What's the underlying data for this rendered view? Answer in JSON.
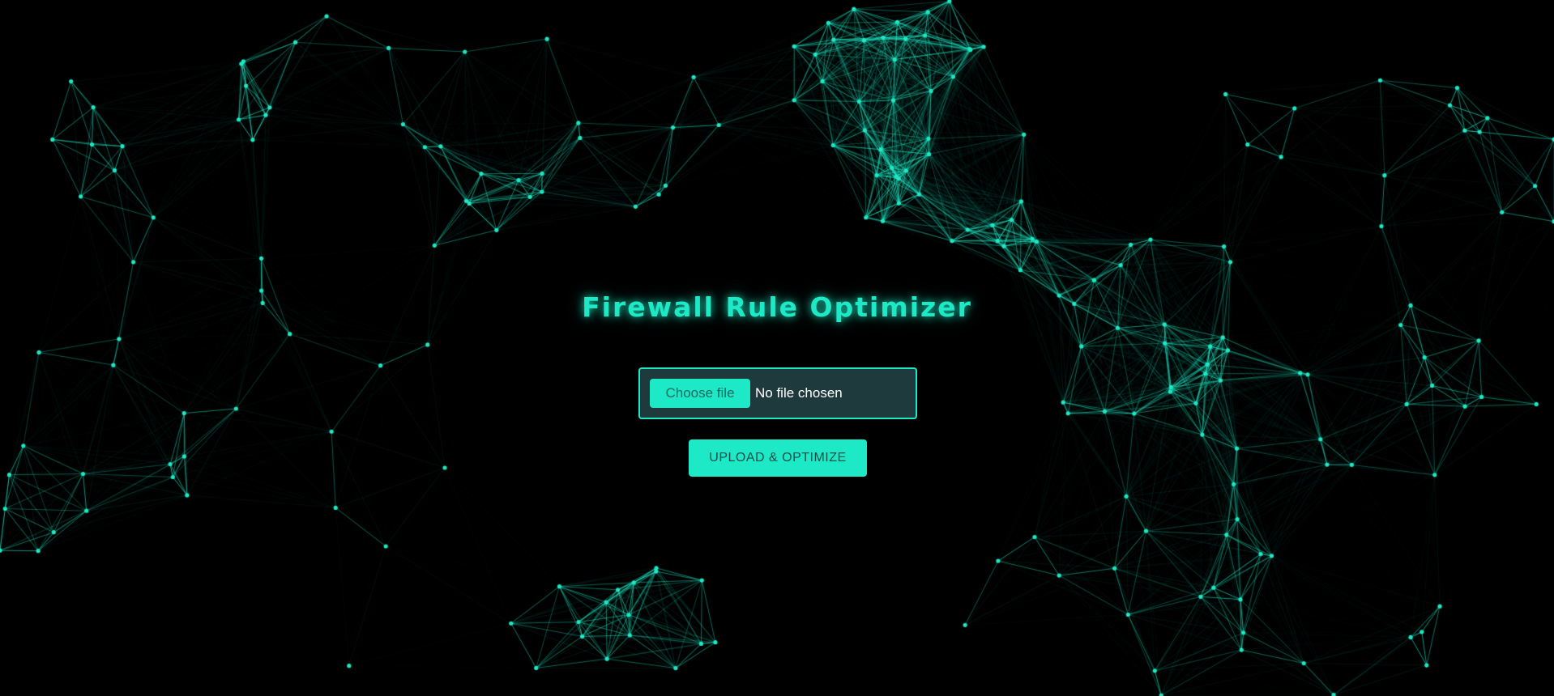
{
  "page": {
    "title": "Firewall Rule Optimizer"
  },
  "file_input": {
    "choose_label": "Choose file",
    "status_text": "No file chosen"
  },
  "actions": {
    "upload_label": "UPLOAD & OPTIMIZE"
  },
  "theme": {
    "background": "#000000",
    "accent": "#1de9c6",
    "panel": "#1f3a3c"
  },
  "background_graphic": "particle-network"
}
